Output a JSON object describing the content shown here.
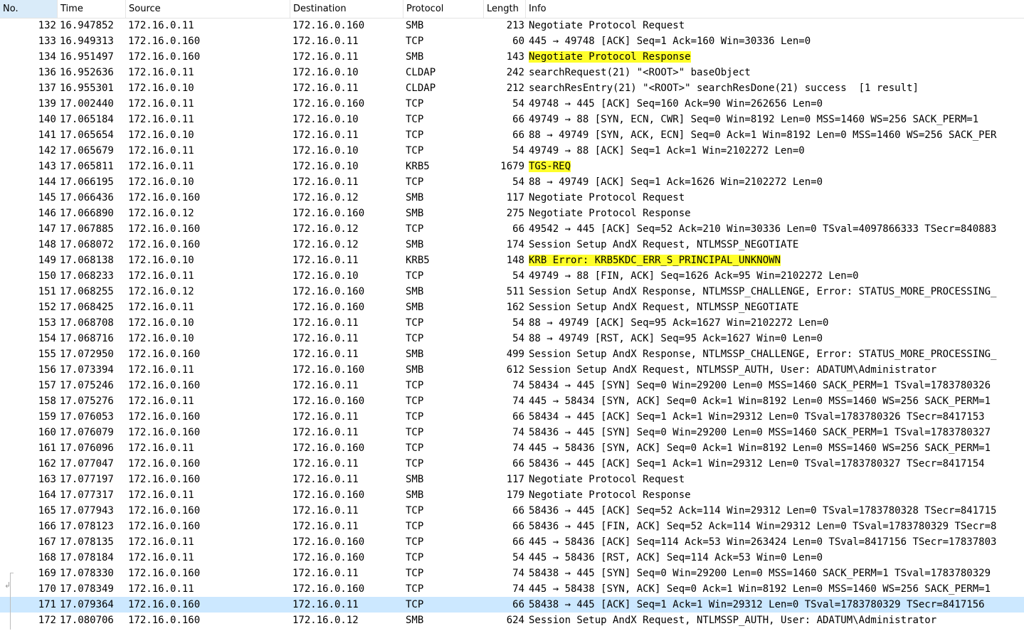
{
  "columns": {
    "no": "No.",
    "time": "Time",
    "source": "Source",
    "destination": "Destination",
    "protocol": "Protocol",
    "length": "Length",
    "info": "Info"
  },
  "colors": {
    "highlight": "#ffff2b",
    "selected_row": "#cce8ff",
    "sorted_header": "#d9ebf9"
  },
  "icons": {
    "related_packet_marker": "corner-arrow-icon"
  },
  "packets": [
    {
      "no": "132",
      "time": "16.947852",
      "source": "172.16.0.11",
      "destination": "172.16.0.160",
      "protocol": "SMB",
      "length": "213",
      "info": "Negotiate Protocol Request"
    },
    {
      "no": "133",
      "time": "16.949313",
      "source": "172.16.0.160",
      "destination": "172.16.0.11",
      "protocol": "TCP",
      "length": "60",
      "info": "445 → 49748 [ACK] Seq=1 Ack=160 Win=30336 Len=0"
    },
    {
      "no": "134",
      "time": "16.951497",
      "source": "172.16.0.160",
      "destination": "172.16.0.11",
      "protocol": "SMB",
      "length": "143",
      "info": "Negotiate Protocol Response",
      "highlight": true
    },
    {
      "no": "136",
      "time": "16.952636",
      "source": "172.16.0.11",
      "destination": "172.16.0.10",
      "protocol": "CLDAP",
      "length": "242",
      "info": "searchRequest(21) \"<ROOT>\" baseObject"
    },
    {
      "no": "137",
      "time": "16.955301",
      "source": "172.16.0.10",
      "destination": "172.16.0.11",
      "protocol": "CLDAP",
      "length": "212",
      "info": "searchResEntry(21) \"<ROOT>\" searchResDone(21) success  [1 result]"
    },
    {
      "no": "139",
      "time": "17.002440",
      "source": "172.16.0.11",
      "destination": "172.16.0.160",
      "protocol": "TCP",
      "length": "54",
      "info": "49748 → 445 [ACK] Seq=160 Ack=90 Win=262656 Len=0"
    },
    {
      "no": "140",
      "time": "17.065184",
      "source": "172.16.0.11",
      "destination": "172.16.0.10",
      "protocol": "TCP",
      "length": "66",
      "info": "49749 → 88 [SYN, ECN, CWR] Seq=0 Win=8192 Len=0 MSS=1460 WS=256 SACK_PERM=1"
    },
    {
      "no": "141",
      "time": "17.065654",
      "source": "172.16.0.10",
      "destination": "172.16.0.11",
      "protocol": "TCP",
      "length": "66",
      "info": "88 → 49749 [SYN, ACK, ECN] Seq=0 Ack=1 Win=8192 Len=0 MSS=1460 WS=256 SACK_PER"
    },
    {
      "no": "142",
      "time": "17.065679",
      "source": "172.16.0.11",
      "destination": "172.16.0.10",
      "protocol": "TCP",
      "length": "54",
      "info": "49749 → 88 [ACK] Seq=1 Ack=1 Win=2102272 Len=0"
    },
    {
      "no": "143",
      "time": "17.065811",
      "source": "172.16.0.11",
      "destination": "172.16.0.10",
      "protocol": "KRB5",
      "length": "1679",
      "info": "TGS-REQ",
      "highlight": true
    },
    {
      "no": "144",
      "time": "17.066195",
      "source": "172.16.0.10",
      "destination": "172.16.0.11",
      "protocol": "TCP",
      "length": "54",
      "info": "88 → 49749 [ACK] Seq=1 Ack=1626 Win=2102272 Len=0"
    },
    {
      "no": "145",
      "time": "17.066436",
      "source": "172.16.0.160",
      "destination": "172.16.0.12",
      "protocol": "SMB",
      "length": "117",
      "info": "Negotiate Protocol Request"
    },
    {
      "no": "146",
      "time": "17.066890",
      "source": "172.16.0.12",
      "destination": "172.16.0.160",
      "protocol": "SMB",
      "length": "275",
      "info": "Negotiate Protocol Response"
    },
    {
      "no": "147",
      "time": "17.067885",
      "source": "172.16.0.160",
      "destination": "172.16.0.12",
      "protocol": "TCP",
      "length": "66",
      "info": "49542 → 445 [ACK] Seq=52 Ack=210 Win=30336 Len=0 TSval=4097866333 TSecr=840883"
    },
    {
      "no": "148",
      "time": "17.068072",
      "source": "172.16.0.160",
      "destination": "172.16.0.12",
      "protocol": "SMB",
      "length": "174",
      "info": "Session Setup AndX Request, NTLMSSP_NEGOTIATE"
    },
    {
      "no": "149",
      "time": "17.068138",
      "source": "172.16.0.10",
      "destination": "172.16.0.11",
      "protocol": "KRB5",
      "length": "148",
      "info": "KRB Error: KRB5KDC_ERR_S_PRINCIPAL_UNKNOWN",
      "highlight": true
    },
    {
      "no": "150",
      "time": "17.068233",
      "source": "172.16.0.11",
      "destination": "172.16.0.10",
      "protocol": "TCP",
      "length": "54",
      "info": "49749 → 88 [FIN, ACK] Seq=1626 Ack=95 Win=2102272 Len=0"
    },
    {
      "no": "151",
      "time": "17.068255",
      "source": "172.16.0.12",
      "destination": "172.16.0.160",
      "protocol": "SMB",
      "length": "511",
      "info": "Session Setup AndX Response, NTLMSSP_CHALLENGE, Error: STATUS_MORE_PROCESSING_"
    },
    {
      "no": "152",
      "time": "17.068425",
      "source": "172.16.0.11",
      "destination": "172.16.0.160",
      "protocol": "SMB",
      "length": "162",
      "info": "Session Setup AndX Request, NTLMSSP_NEGOTIATE"
    },
    {
      "no": "153",
      "time": "17.068708",
      "source": "172.16.0.10",
      "destination": "172.16.0.11",
      "protocol": "TCP",
      "length": "54",
      "info": "88 → 49749 [ACK] Seq=95 Ack=1627 Win=2102272 Len=0"
    },
    {
      "no": "154",
      "time": "17.068716",
      "source": "172.16.0.10",
      "destination": "172.16.0.11",
      "protocol": "TCP",
      "length": "54",
      "info": "88 → 49749 [RST, ACK] Seq=95 Ack=1627 Win=0 Len=0"
    },
    {
      "no": "155",
      "time": "17.072950",
      "source": "172.16.0.160",
      "destination": "172.16.0.11",
      "protocol": "SMB",
      "length": "499",
      "info": "Session Setup AndX Response, NTLMSSP_CHALLENGE, Error: STATUS_MORE_PROCESSING_"
    },
    {
      "no": "156",
      "time": "17.073394",
      "source": "172.16.0.11",
      "destination": "172.16.0.160",
      "protocol": "SMB",
      "length": "612",
      "info": "Session Setup AndX Request, NTLMSSP_AUTH, User: ADATUM\\Administrator"
    },
    {
      "no": "157",
      "time": "17.075246",
      "source": "172.16.0.160",
      "destination": "172.16.0.11",
      "protocol": "TCP",
      "length": "74",
      "info": "58434 → 445 [SYN] Seq=0 Win=29200 Len=0 MSS=1460 SACK_PERM=1 TSval=1783780326"
    },
    {
      "no": "158",
      "time": "17.075276",
      "source": "172.16.0.11",
      "destination": "172.16.0.160",
      "protocol": "TCP",
      "length": "74",
      "info": "445 → 58434 [SYN, ACK] Seq=0 Ack=1 Win=8192 Len=0 MSS=1460 WS=256 SACK_PERM=1"
    },
    {
      "no": "159",
      "time": "17.076053",
      "source": "172.16.0.160",
      "destination": "172.16.0.11",
      "protocol": "TCP",
      "length": "66",
      "info": "58434 → 445 [ACK] Seq=1 Ack=1 Win=29312 Len=0 TSval=1783780326 TSecr=8417153"
    },
    {
      "no": "160",
      "time": "17.076079",
      "source": "172.16.0.160",
      "destination": "172.16.0.11",
      "protocol": "TCP",
      "length": "74",
      "info": "58436 → 445 [SYN] Seq=0 Win=29200 Len=0 MSS=1460 SACK_PERM=1 TSval=1783780327"
    },
    {
      "no": "161",
      "time": "17.076096",
      "source": "172.16.0.11",
      "destination": "172.16.0.160",
      "protocol": "TCP",
      "length": "74",
      "info": "445 → 58436 [SYN, ACK] Seq=0 Ack=1 Win=8192 Len=0 MSS=1460 WS=256 SACK_PERM=1"
    },
    {
      "no": "162",
      "time": "17.077047",
      "source": "172.16.0.160",
      "destination": "172.16.0.11",
      "protocol": "TCP",
      "length": "66",
      "info": "58436 → 445 [ACK] Seq=1 Ack=1 Win=29312 Len=0 TSval=1783780327 TSecr=8417154"
    },
    {
      "no": "163",
      "time": "17.077197",
      "source": "172.16.0.160",
      "destination": "172.16.0.11",
      "protocol": "SMB",
      "length": "117",
      "info": "Negotiate Protocol Request"
    },
    {
      "no": "164",
      "time": "17.077317",
      "source": "172.16.0.11",
      "destination": "172.16.0.160",
      "protocol": "SMB",
      "length": "179",
      "info": "Negotiate Protocol Response"
    },
    {
      "no": "165",
      "time": "17.077943",
      "source": "172.16.0.160",
      "destination": "172.16.0.11",
      "protocol": "TCP",
      "length": "66",
      "info": "58436 → 445 [ACK] Seq=52 Ack=114 Win=29312 Len=0 TSval=1783780328 TSecr=841715"
    },
    {
      "no": "166",
      "time": "17.078123",
      "source": "172.16.0.160",
      "destination": "172.16.0.11",
      "protocol": "TCP",
      "length": "66",
      "info": "58436 → 445 [FIN, ACK] Seq=52 Ack=114 Win=29312 Len=0 TSval=1783780329 TSecr=8"
    },
    {
      "no": "167",
      "time": "17.078135",
      "source": "172.16.0.11",
      "destination": "172.16.0.160",
      "protocol": "TCP",
      "length": "66",
      "info": "445 → 58436 [ACK] Seq=114 Ack=53 Win=263424 Len=0 TSval=8417156 TSecr=17837803"
    },
    {
      "no": "168",
      "time": "17.078184",
      "source": "172.16.0.11",
      "destination": "172.16.0.160",
      "protocol": "TCP",
      "length": "54",
      "info": "445 → 58436 [RST, ACK] Seq=114 Ack=53 Win=0 Len=0"
    },
    {
      "no": "169",
      "time": "17.078330",
      "source": "172.16.0.160",
      "destination": "172.16.0.11",
      "protocol": "TCP",
      "length": "74",
      "info": "58438 → 445 [SYN] Seq=0 Win=29200 Len=0 MSS=1460 SACK_PERM=1 TSval=1783780329"
    },
    {
      "no": "170",
      "time": "17.078349",
      "source": "172.16.0.11",
      "destination": "172.16.0.160",
      "protocol": "TCP",
      "length": "74",
      "info": "445 → 58438 [SYN, ACK] Seq=0 Ack=1 Win=8192 Len=0 MSS=1460 WS=256 SACK_PERM=1"
    },
    {
      "no": "171",
      "time": "17.079364",
      "source": "172.16.0.160",
      "destination": "172.16.0.11",
      "protocol": "TCP",
      "length": "66",
      "info": "58438 → 445 [ACK] Seq=1 Ack=1 Win=29312 Len=0 TSval=1783780329 TSecr=8417156",
      "selected": true
    },
    {
      "no": "172",
      "time": "17.080706",
      "source": "172.16.0.160",
      "destination": "172.16.0.12",
      "protocol": "SMB",
      "length": "624",
      "info": "Session Setup AndX Request, NTLMSSP_AUTH, User: ADATUM\\Administrator"
    }
  ]
}
